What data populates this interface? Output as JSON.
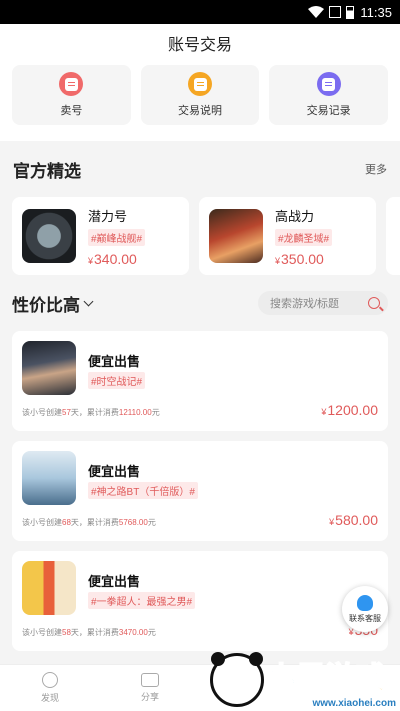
{
  "statusbar": {
    "time": "11:35"
  },
  "header": {
    "title": "账号交易"
  },
  "quick_actions": [
    {
      "label": "卖号",
      "icon": "sell-icon",
      "color": "#f06a6a"
    },
    {
      "label": "交易说明",
      "icon": "guide-icon",
      "color": "#f5a623"
    },
    {
      "label": "交易记录",
      "icon": "record-icon",
      "color": "#7b6cf0"
    }
  ],
  "featured": {
    "title": "官方精选",
    "more": "更多",
    "items": [
      {
        "name": "潜力号",
        "tag": "#巅峰战舰#",
        "currency": "¥",
        "price": "340.00"
      },
      {
        "name": "高战力",
        "tag": "#龙麟圣域#",
        "currency": "¥",
        "price": "350.00"
      }
    ]
  },
  "value": {
    "title": "性价比高",
    "search_placeholder": "搜索游戏/标题",
    "listings": [
      {
        "name": "便宜出售",
        "tag": "#时空战记#",
        "meta_pre": "该小号创建",
        "days": "57",
        "meta_mid": "天，累计消费",
        "spent": "12110.00",
        "meta_unit": "元",
        "currency": "¥",
        "price": "1200.00"
      },
      {
        "name": "便宜出售",
        "tag": "#神之路BT（千倍版）#",
        "meta_pre": "该小号创建",
        "days": "68",
        "meta_mid": "天，累计消费",
        "spent": "5768.00",
        "meta_unit": "元",
        "currency": "¥",
        "price": "580.00"
      },
      {
        "name": "便宜出售",
        "tag": "#一拳超人：最强之男#",
        "meta_pre": "该小号创建",
        "days": "58",
        "meta_mid": "天，累计消费",
        "spent": "3470.00",
        "meta_unit": "元",
        "currency": "¥",
        "price": "350"
      }
    ]
  },
  "service": {
    "label": "联系客服"
  },
  "tabs": [
    {
      "label": "发现"
    },
    {
      "label": "分享"
    }
  ],
  "watermark": {
    "text_a": "小",
    "text_b": "黑游戏",
    "url": "www.xiaohei.com"
  },
  "colors": {
    "accent": "#e05a5a",
    "tag_bg": "#fde9e9"
  }
}
